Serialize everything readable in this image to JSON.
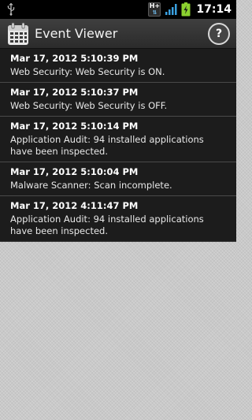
{
  "status_bar": {
    "network_label": "H+",
    "time": "17:14"
  },
  "app": {
    "title": "Event Viewer",
    "help_label": "?"
  },
  "events": [
    {
      "date": "Mar 17, 2012 5:10:39 PM",
      "message": "Web Security: Web Security is ON."
    },
    {
      "date": "Mar 17, 2012 5:10:37 PM",
      "message": "Web Security: Web Security is OFF."
    },
    {
      "date": "Mar 17, 2012 5:10:14 PM",
      "message": "Application Audit: 94 installed applications have been inspected."
    },
    {
      "date": "Mar 17, 2012 5:10:04 PM",
      "message": "Malware Scanner: Scan incomplete."
    },
    {
      "date": "Mar 17, 2012 4:11:47 PM",
      "message": "Application Audit: 94 installed applications have been inspected."
    }
  ],
  "colors": {
    "status_bar": "#000000",
    "action_bar": "#333333",
    "list_bg": "#1c1c1c",
    "page_bg": "#c9c9c9",
    "battery_green": "#8bd12f",
    "signal_blue": "#3aa0e0"
  }
}
